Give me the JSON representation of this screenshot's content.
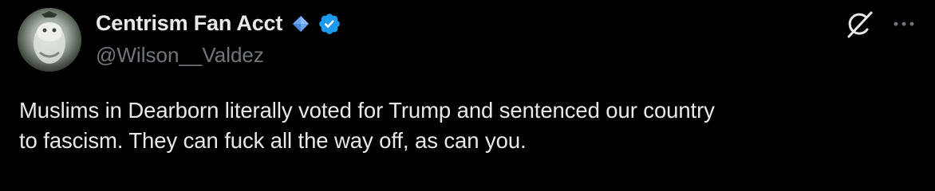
{
  "author": {
    "display_name": "Centrism Fan Acct",
    "handle": "@Wilson__Valdez"
  },
  "icons": {
    "diamond": "diamond-icon",
    "verified": "verified-badge-icon",
    "grok": "grok-icon",
    "more": "more-options-icon"
  },
  "colors": {
    "background": "#000000",
    "text": "#e7e9ea",
    "muted": "#71767b",
    "verified_blue": "#1d9bf0",
    "diamond_blue": "#6aa5f5"
  },
  "tweet": {
    "text_line_1": "Muslims in Dearborn literally voted for Trump and sentenced our country",
    "text_line_2": "to fascism. They can fuck all the way off, as can you."
  }
}
